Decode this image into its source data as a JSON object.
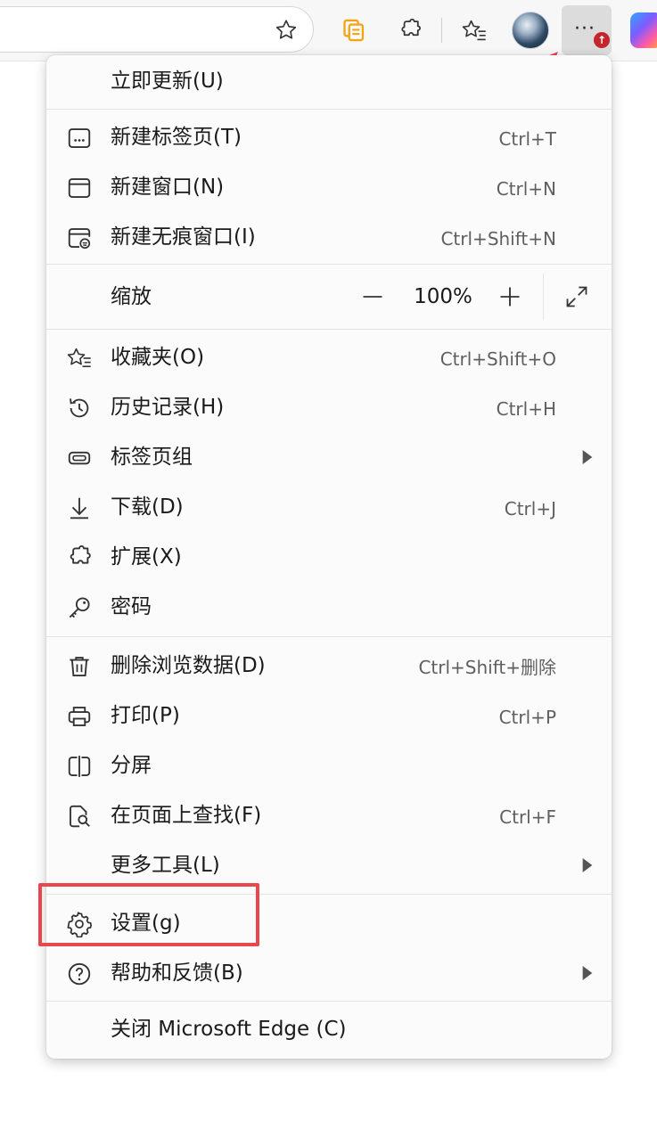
{
  "menu": {
    "update": {
      "label": "立即更新(U)"
    },
    "new_tab": {
      "label": "新建标签页(T)",
      "shortcut": "Ctrl+T"
    },
    "new_window": {
      "label": "新建窗口(N)",
      "shortcut": "Ctrl+N"
    },
    "new_inprivate": {
      "label": "新建无痕窗口(I)",
      "shortcut": "Ctrl+Shift+N"
    },
    "zoom": {
      "label": "缩放",
      "value": "100%",
      "minus": "—",
      "plus": "+"
    },
    "favorites": {
      "label": "收藏夹(O)",
      "shortcut": "Ctrl+Shift+O"
    },
    "history": {
      "label": "历史记录(H)",
      "shortcut": "Ctrl+H"
    },
    "tab_groups": {
      "label": "标签页组"
    },
    "downloads": {
      "label": "下载(D)",
      "shortcut": "Ctrl+J"
    },
    "extensions": {
      "label": "扩展(X)"
    },
    "passwords": {
      "label": "密码"
    },
    "clear_data": {
      "label": "删除浏览数据(D)",
      "shortcut": "Ctrl+Shift+删除"
    },
    "print": {
      "label": "打印(P)",
      "shortcut": "Ctrl+P"
    },
    "split_screen": {
      "label": "分屏"
    },
    "find": {
      "label": "在页面上查找(F)",
      "shortcut": "Ctrl+F"
    },
    "more_tools": {
      "label": "更多工具(L)"
    },
    "settings": {
      "label": "设置(g)"
    },
    "help": {
      "label": "帮助和反馈(B)"
    },
    "close_edge": {
      "label": "关闭 Microsoft Edge (C)"
    }
  },
  "toolbar": {
    "update_badge": "↑"
  },
  "annotation_colors": {
    "highlight": "#e8474d",
    "arrow": "#e8474d"
  },
  "icons": [
    "star-icon",
    "collections-icon",
    "extensions-icon",
    "favorites-icon",
    "more-icon",
    "copilot-icon"
  ]
}
